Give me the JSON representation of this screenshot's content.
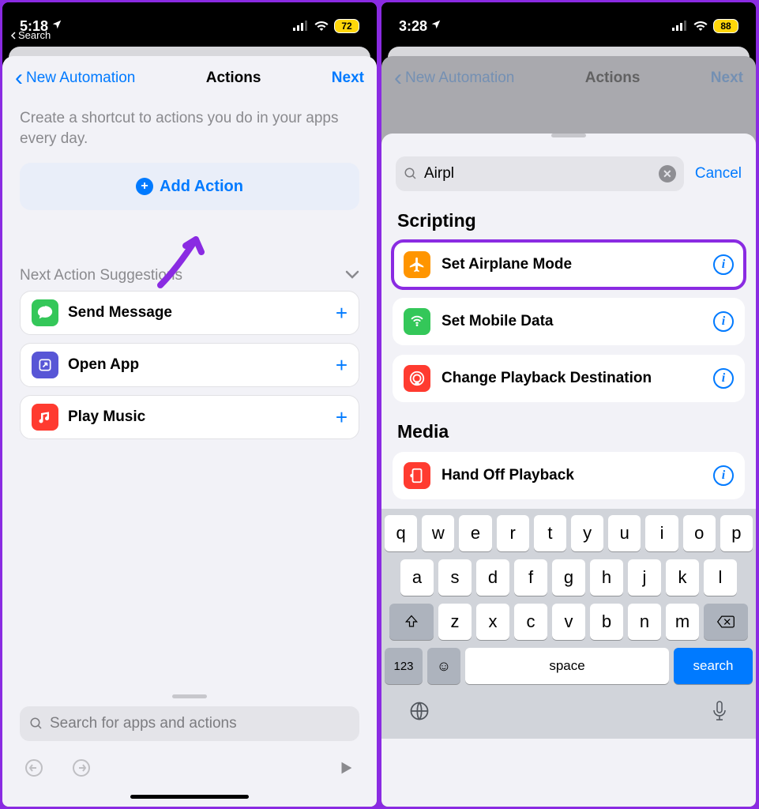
{
  "left": {
    "status": {
      "time": "5:18",
      "back_label": "Search",
      "battery": "72"
    },
    "nav": {
      "back": "New Automation",
      "title": "Actions",
      "next": "Next"
    },
    "intro": "Create a shortcut to actions you do in your apps every day.",
    "add_action": "Add Action",
    "nas_header": "Next Action Suggestions",
    "suggestions": [
      {
        "label": "Send Message"
      },
      {
        "label": "Open App"
      },
      {
        "label": "Play Music"
      }
    ],
    "search_placeholder": "Search for apps and actions"
  },
  "right": {
    "status": {
      "time": "3:28",
      "battery": "88"
    },
    "nav": {
      "back": "New Automation",
      "title": "Actions",
      "next": "Next"
    },
    "search_value": "Airpl",
    "cancel": "Cancel",
    "sections": {
      "scripting": {
        "header": "Scripting",
        "items": [
          {
            "label": "Set Airplane Mode",
            "highlighted": true
          },
          {
            "label": "Set Mobile Data"
          },
          {
            "label": "Change Playback Destination"
          }
        ]
      },
      "media": {
        "header": "Media",
        "items": [
          {
            "label": "Hand Off Playback"
          }
        ]
      }
    },
    "keyboard": {
      "row1": [
        "q",
        "w",
        "e",
        "r",
        "t",
        "y",
        "u",
        "i",
        "o",
        "p"
      ],
      "row2": [
        "a",
        "s",
        "d",
        "f",
        "g",
        "h",
        "j",
        "k",
        "l"
      ],
      "row3": [
        "z",
        "x",
        "c",
        "v",
        "b",
        "n",
        "m"
      ],
      "numbers": "123",
      "space": "space",
      "search": "search"
    }
  }
}
